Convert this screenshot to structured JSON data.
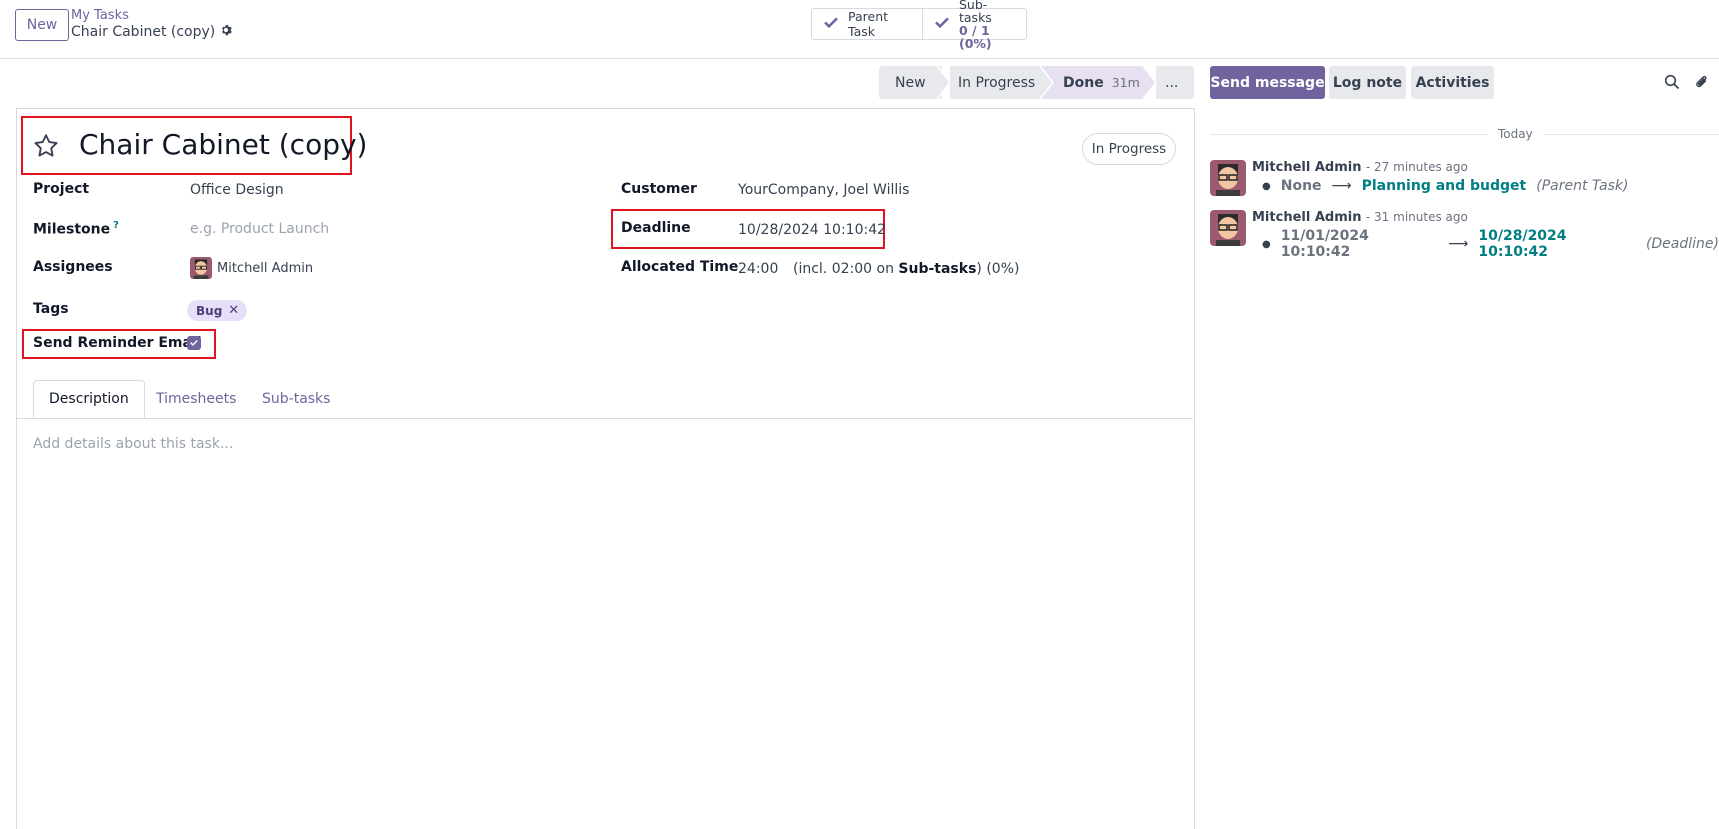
{
  "control_panel": {
    "new_button": "New",
    "breadcrumb_parent": "My Tasks",
    "breadcrumb_current": "Chair Cabinet (copy)",
    "smart_buttons": {
      "parent_task": "Parent Task",
      "subtasks_label": "Sub-tasks",
      "subtasks_value": "0 / 1 (0%)"
    }
  },
  "statusbar": {
    "stages": [
      "New",
      "In Progress",
      "Done"
    ],
    "done_duration": "31m",
    "more": "..."
  },
  "chatter_actions": {
    "send_message": "Send message",
    "log_note": "Log note",
    "activities": "Activities"
  },
  "form": {
    "title": "Chair Cabinet (copy)",
    "state_badge": "In Progress",
    "fields": {
      "project_label": "Project",
      "project_value": "Office Design",
      "milestone_label": "Milestone",
      "milestone_help": "?",
      "milestone_placeholder": "e.g. Product Launch",
      "assignees_label": "Assignees",
      "assignees_value": "Mitchell Admin",
      "tags_label": "Tags",
      "tag_bug": "Bug",
      "reminder_label": "Send Reminder Email",
      "reminder_checked": true,
      "customer_label": "Customer",
      "customer_value": "YourCompany, Joel Willis",
      "deadline_label": "Deadline",
      "deadline_value": "10/28/2024 10:10:42",
      "allocated_label": "Allocated Time",
      "allocated_value": "24:00",
      "allocated_incl_prefix": "(incl. 02:00 on",
      "allocated_incl_link": "Sub-tasks",
      "allocated_incl_suffix": ") (0%)"
    },
    "tabs": [
      "Description",
      "Timesheets",
      "Sub-tasks"
    ],
    "description_placeholder": "Add details about this task..."
  },
  "chatter": {
    "date_separator": "Today",
    "messages": [
      {
        "author": "Mitchell Admin",
        "time": "- 27 minutes ago",
        "old": "None",
        "arrow": "⟶",
        "new": "Planning and budget",
        "field": "(Parent Task)"
      },
      {
        "author": "Mitchell Admin",
        "time": "- 31 minutes ago",
        "old": "11/01/2024 10:10:42",
        "arrow": "⟶",
        "new": "10/28/2024 10:10:42",
        "field": "(Deadline)"
      }
    ]
  },
  "colors": {
    "brand": "#71639e",
    "link_teal": "#017e84",
    "highlight_red": "#e0141e",
    "tag_bg": "#e6dff7"
  },
  "icons": [
    "gear-icon",
    "check-icon",
    "star-icon",
    "search-icon",
    "paperclip-icon",
    "close-icon",
    "checkbox-checked-icon"
  ]
}
